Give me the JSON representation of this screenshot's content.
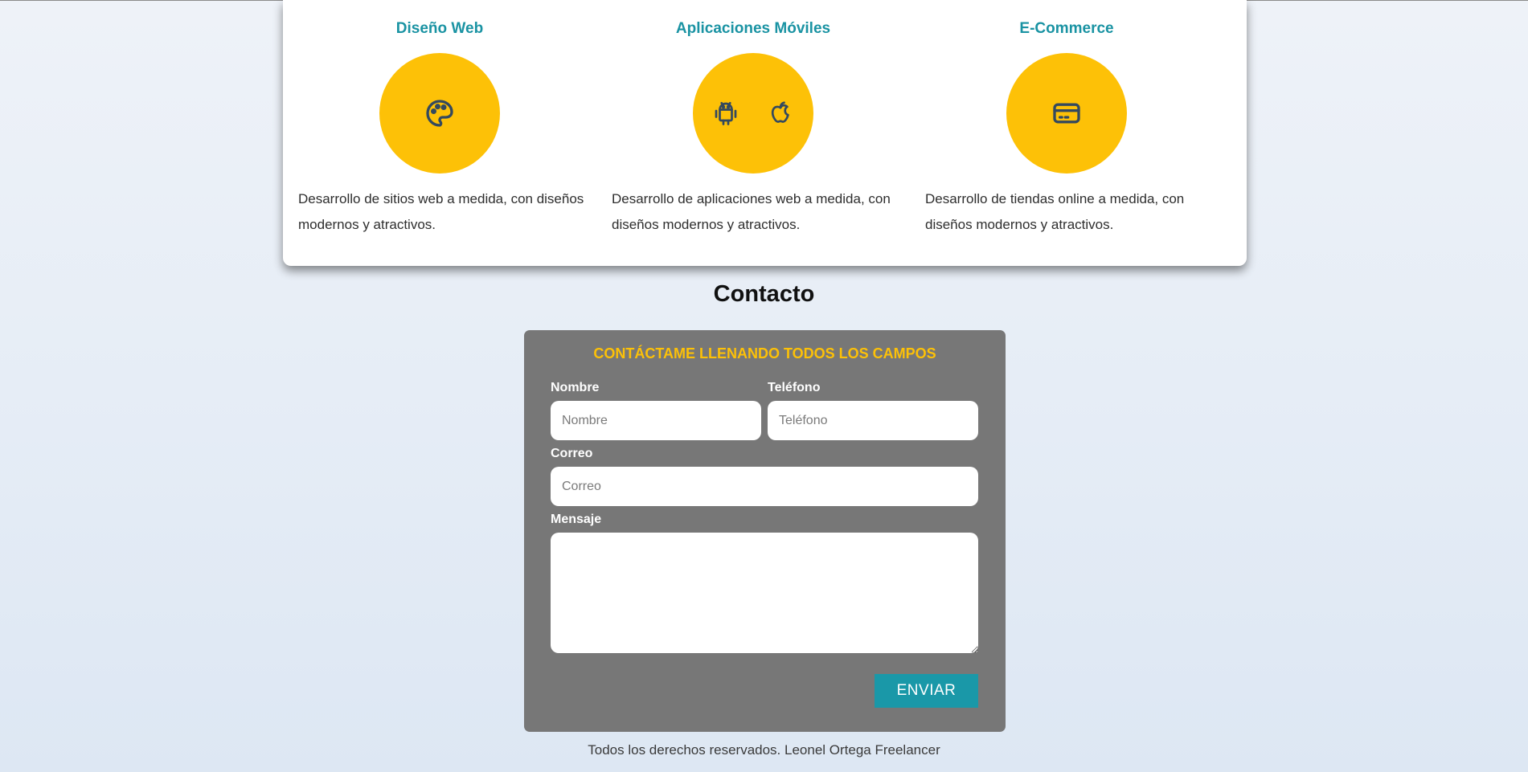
{
  "services": [
    {
      "title": "Diseño Web",
      "icons": [
        "palette-icon"
      ],
      "description": "Desarrollo de sitios web a medida, con diseños modernos y atractivos."
    },
    {
      "title": "Aplicaciones Móviles",
      "icons": [
        "android-icon",
        "apple-icon"
      ],
      "description": "Desarrollo de aplicaciones web a medida, con diseños modernos y atractivos."
    },
    {
      "title": "E-Commerce",
      "icons": [
        "credit-card-icon"
      ],
      "description": "Desarrollo de tiendas online a medida, con diseños modernos y atractivos."
    }
  ],
  "contact": {
    "title": "Contacto",
    "heading": "CONTÁCTAME LLENANDO TODOS LOS CAMPOS",
    "fields": {
      "nombre": {
        "label": "Nombre",
        "placeholder": "Nombre",
        "value": ""
      },
      "telefono": {
        "label": "Teléfono",
        "placeholder": "Teléfono",
        "value": ""
      },
      "correo": {
        "label": "Correo",
        "placeholder": "Correo",
        "value": ""
      },
      "mensaje": {
        "label": "Mensaje",
        "placeholder": "",
        "value": ""
      }
    },
    "submit_label": "ENVIAR"
  },
  "footer": {
    "text": "Todos los derechos reservados. Leonel Ortega Freelancer"
  },
  "colors": {
    "accent_teal": "#1a93a3",
    "accent_yellow": "#fdc107",
    "form_background": "#777777",
    "button_background": "#1a98a8"
  }
}
